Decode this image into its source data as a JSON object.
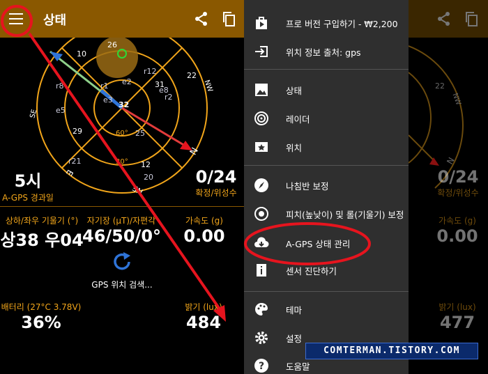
{
  "colors": {
    "appbar": "#8a5800",
    "orange": "#f1a51a",
    "drawer": "#2f2f2f",
    "accent_blue": "#2f74d8",
    "annotation_red": "#e6141e"
  },
  "left": {
    "appbar": {
      "title": "상태"
    },
    "radar": {
      "directions": {
        "north": "N",
        "northeast": "NE",
        "east": "E",
        "southeast": "SE",
        "northwest": "NW"
      },
      "elevations": [
        "30°",
        "60°"
      ],
      "sats_yellow": [
        "26",
        "10",
        "29",
        "31",
        "22",
        "12",
        "20",
        "25",
        "33"
      ],
      "sats_blue": [
        "r8",
        "e5",
        "r1",
        "e3",
        "e2",
        "r12",
        "e8",
        "r2",
        "r21",
        "r20"
      ],
      "sat_highlight": "32"
    },
    "stats": {
      "time_value": "5시",
      "time_label": "A-GPS 경과일",
      "sats_value": "0/24",
      "sats_label": "확정/위성수",
      "tilt_label": "상하/좌우 기울기 (°)",
      "tilt_value": "상38 우04",
      "mag_label": "자기장 (µT)/자편각",
      "mag_value": "46/50/0°",
      "accel_label": "가속도 (g)",
      "accel_value": "0.00",
      "searching": "GPS 위치 검색...",
      "battery_label": "배터리 (27°C 3.78V)",
      "battery_value": "36%",
      "light_label": "밝기 (lux)",
      "light_value": "484"
    }
  },
  "right": {
    "menu": [
      {
        "label": "프로 버전 구입하기 - ₩2,200",
        "icon": "play-store-icon"
      },
      {
        "label": "위치 정보 출처: gps",
        "icon": "login-icon"
      },
      {
        "label": "상태",
        "icon": "image-icon"
      },
      {
        "label": "레이더",
        "icon": "radar-icon"
      },
      {
        "label": "위치",
        "icon": "map-icon"
      },
      {
        "label": "나침반 보정",
        "icon": "compass-icon"
      },
      {
        "label": "피치(높낮이) 및 롤(기울기) 보정",
        "icon": "target-icon"
      },
      {
        "label": "A-GPS 상태 관리",
        "icon": "cloud-download-icon"
      },
      {
        "label": "센서 진단하기",
        "icon": "info-icon"
      },
      {
        "label": "테마",
        "icon": "palette-icon"
      },
      {
        "label": "설정",
        "icon": "gear-icon"
      },
      {
        "label": "도움말",
        "icon": "help-icon"
      }
    ],
    "behind": {
      "sats_value": "0/24",
      "sats_label": "확정/위성수",
      "accel_label": "가속도 (g)",
      "accel_value": "0.00",
      "light_label": "밝기 (lux)",
      "light_value": "477",
      "sat_22": "22",
      "dir_nw": "NW",
      "dir_n": "N"
    }
  },
  "watermark": "COMTERMAN.TISTORY.COM"
}
